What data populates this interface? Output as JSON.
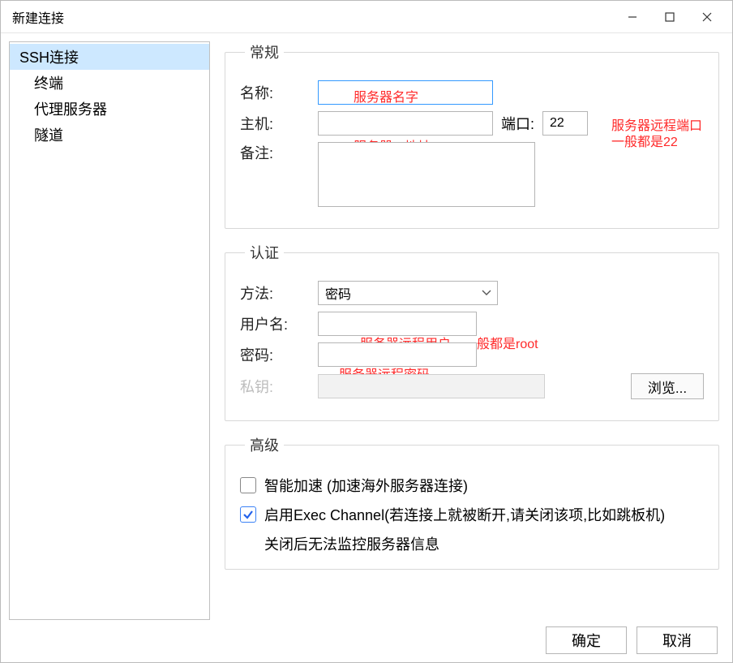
{
  "titlebar": {
    "title": "新建连接"
  },
  "sidebar": {
    "items": [
      {
        "label": "SSH连接",
        "selected": true
      },
      {
        "label": "终端",
        "selected": false
      },
      {
        "label": "代理服务器",
        "selected": false
      },
      {
        "label": "隧道",
        "selected": false
      }
    ]
  },
  "groups": {
    "general": {
      "legend": "常规",
      "name_label": "名称:",
      "name_value": "",
      "name_annotation": "服务器名字",
      "host_label": "主机:",
      "host_value": "",
      "host_annotation": "服务器IP地址",
      "port_label": "端口:",
      "port_value": "22",
      "port_annotation_line1": "服务器远程端口",
      "port_annotation_line2": "一般都是22",
      "notes_label": "备注:",
      "notes_value": ""
    },
    "auth": {
      "legend": "认证",
      "method_label": "方法:",
      "method_value": "密码",
      "user_label": "用户名:",
      "user_value": "",
      "user_annotation": "服务器远程用户，一般都是root",
      "password_label": "密码:",
      "password_value": "",
      "password_annotation": "服务器远程密码",
      "privkey_label": "私钥:",
      "privkey_value": "",
      "browse_label": "浏览..."
    },
    "advanced": {
      "legend": "高级",
      "smart_accel_checked": false,
      "smart_accel_label": "智能加速 (加速海外服务器连接)",
      "exec_channel_checked": true,
      "exec_channel_label": "启用Exec Channel(若连接上就被断开,请关闭该项,比如跳板机)",
      "exec_channel_sublabel": "关闭后无法监控服务器信息"
    }
  },
  "footer": {
    "ok": "确定",
    "cancel": "取消"
  }
}
